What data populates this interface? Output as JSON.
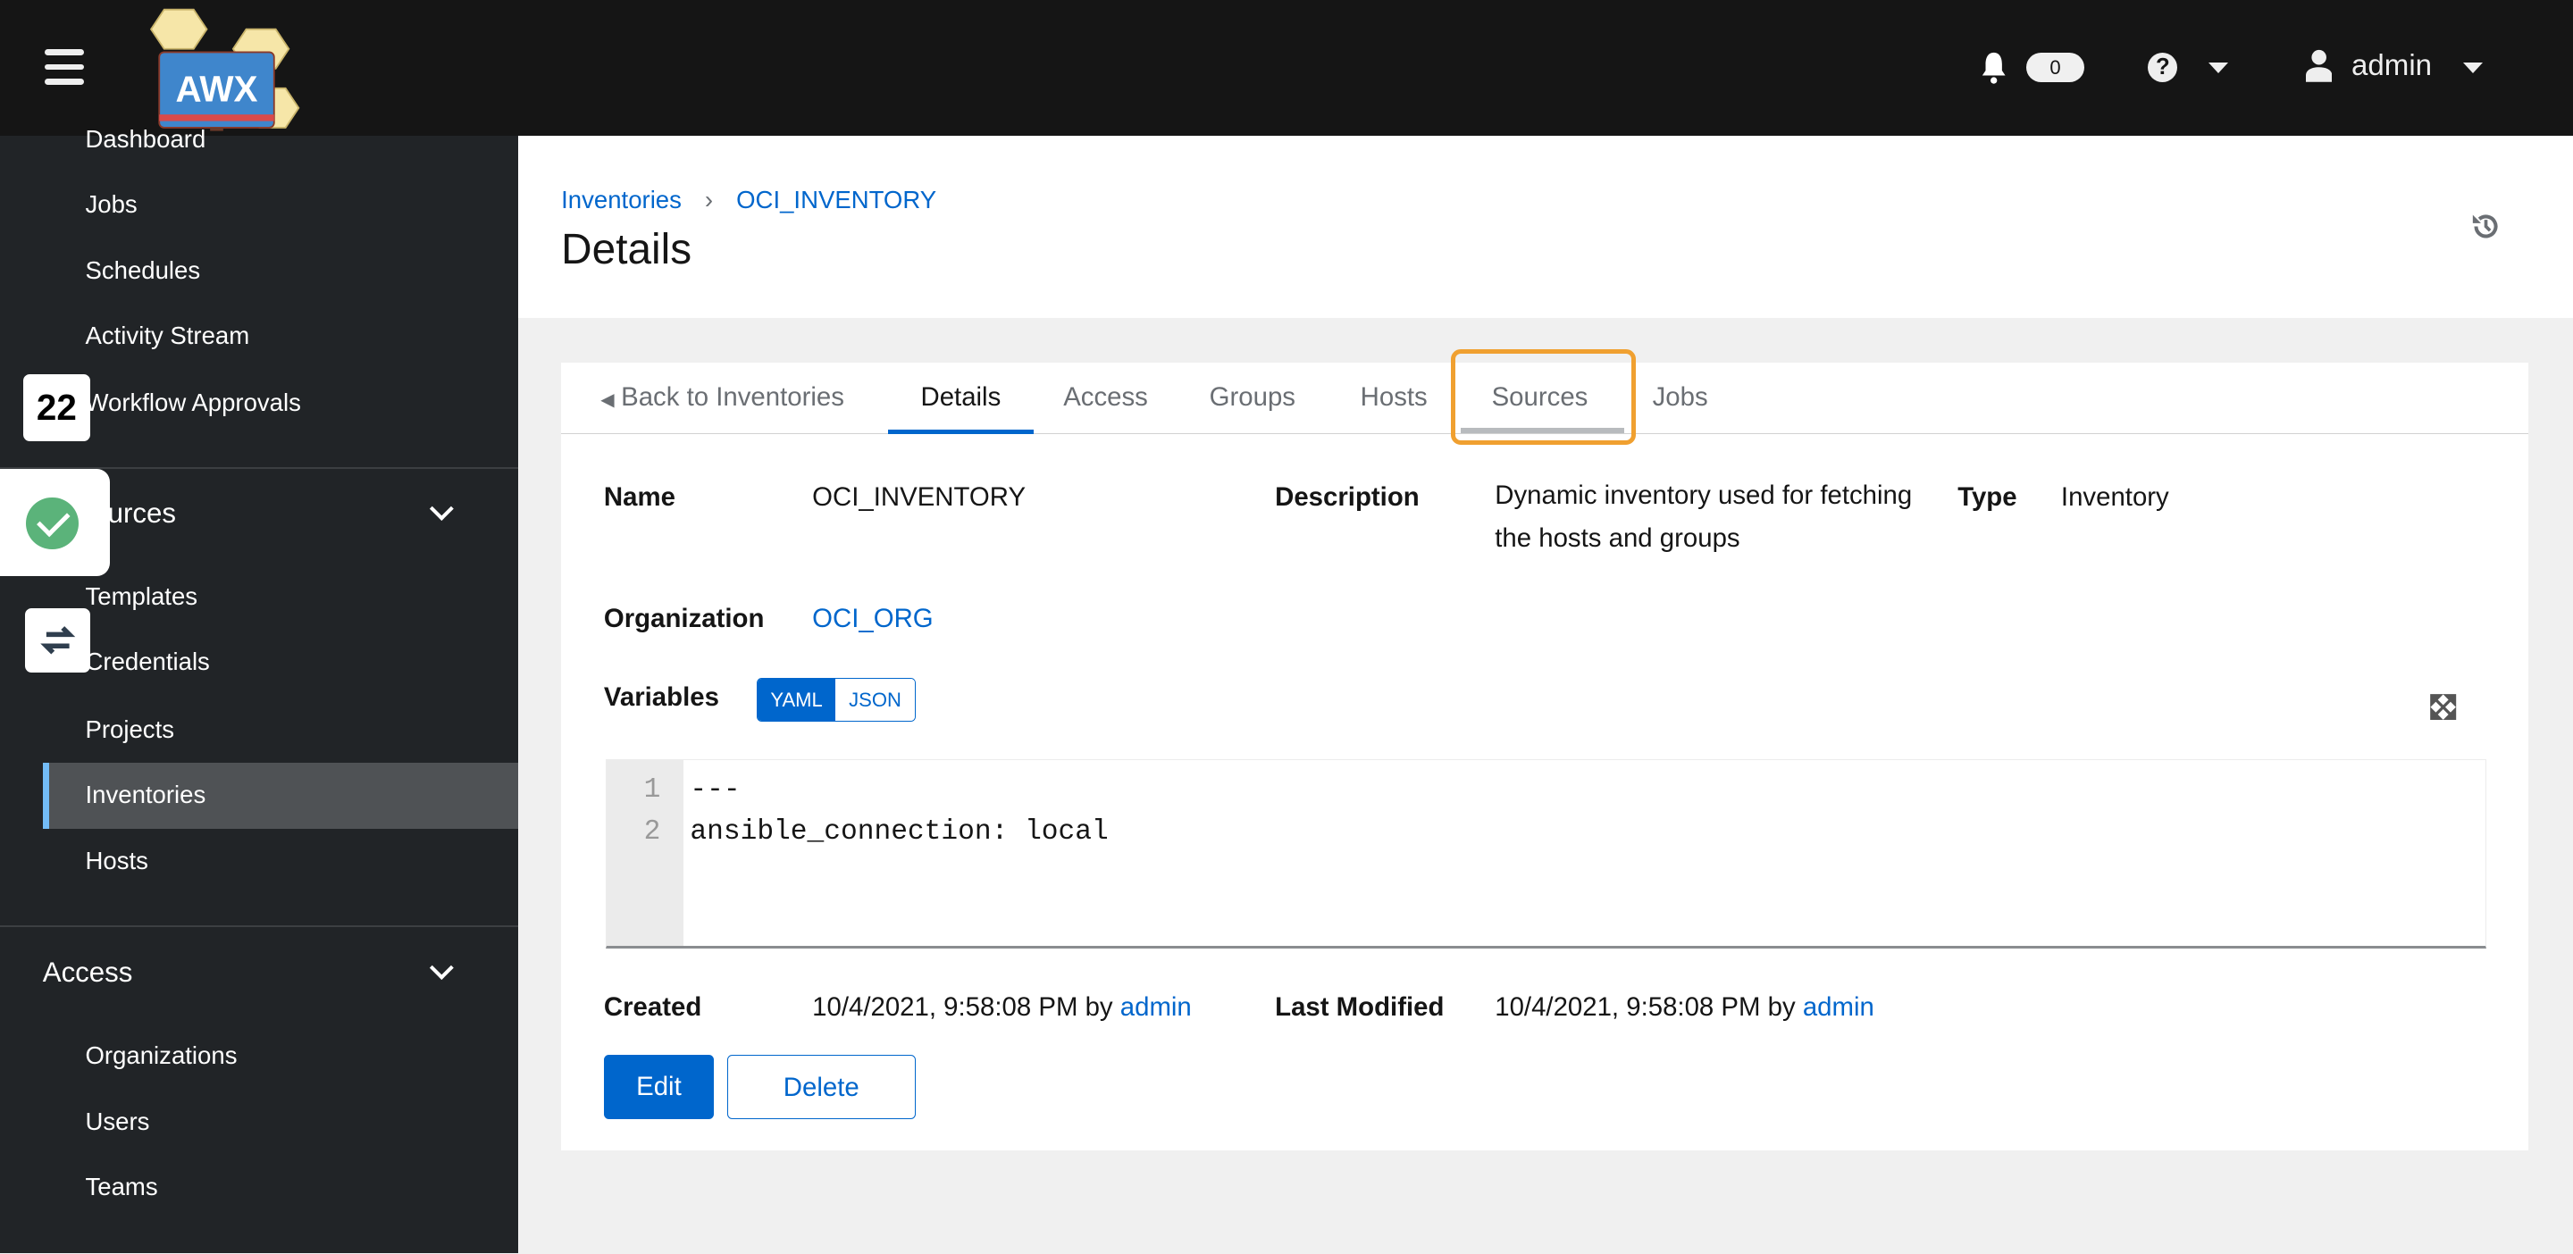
{
  "header": {
    "app_logo_text": "AWX",
    "notifications_count": "0",
    "user": "admin"
  },
  "sidebar": {
    "views_items": [
      {
        "label": "Dashboard"
      },
      {
        "label": "Jobs"
      },
      {
        "label": "Schedules"
      },
      {
        "label": "Activity Stream"
      },
      {
        "label": "Workflow Approvals"
      }
    ],
    "resources_label": "Resources",
    "resources_items": [
      {
        "label": "Templates"
      },
      {
        "label": "Credentials"
      },
      {
        "label": "Projects"
      },
      {
        "label": "Inventories",
        "active": true
      },
      {
        "label": "Hosts"
      }
    ],
    "access_label": "Access",
    "access_items": [
      {
        "label": "Organizations"
      },
      {
        "label": "Users"
      },
      {
        "label": "Teams"
      }
    ]
  },
  "overlays": {
    "badge_number": "22"
  },
  "breadcrumb": [
    {
      "label": "Inventories"
    },
    {
      "label": "OCI_INVENTORY"
    }
  ],
  "page_title": "Details",
  "tabs": [
    {
      "label": "Back to Inventories"
    },
    {
      "label": "Details",
      "active": true
    },
    {
      "label": "Access"
    },
    {
      "label": "Groups"
    },
    {
      "label": "Hosts"
    },
    {
      "label": "Sources",
      "highlighted": true
    },
    {
      "label": "Jobs"
    }
  ],
  "details": {
    "name_label": "Name",
    "name": "OCI_INVENTORY",
    "description_label": "Description",
    "description": "Dynamic inventory used for fetching the hosts and groups",
    "type_label": "Type",
    "type": "Inventory",
    "organization_label": "Organization",
    "organization": "OCI_ORG",
    "variables_label": "Variables",
    "toggle_yaml": "YAML",
    "toggle_json": "JSON",
    "toggle_selected": "YAML",
    "code_lines": [
      {
        "n": "1",
        "text": "---"
      },
      {
        "n": "2",
        "text": "ansible_connection: local"
      }
    ],
    "created_label": "Created",
    "created": "10/4/2021, 9:58:08 PM by",
    "created_by": "admin",
    "modified_label": "Last Modified",
    "modified": "10/4/2021, 9:58:08 PM by",
    "modified_by": "admin"
  },
  "buttons": {
    "edit": "Edit",
    "delete": "Delete"
  },
  "colors": {
    "accent": "#0066cc",
    "header": "#151515",
    "sidebar": "#212427",
    "highlight": "#f0a030"
  }
}
